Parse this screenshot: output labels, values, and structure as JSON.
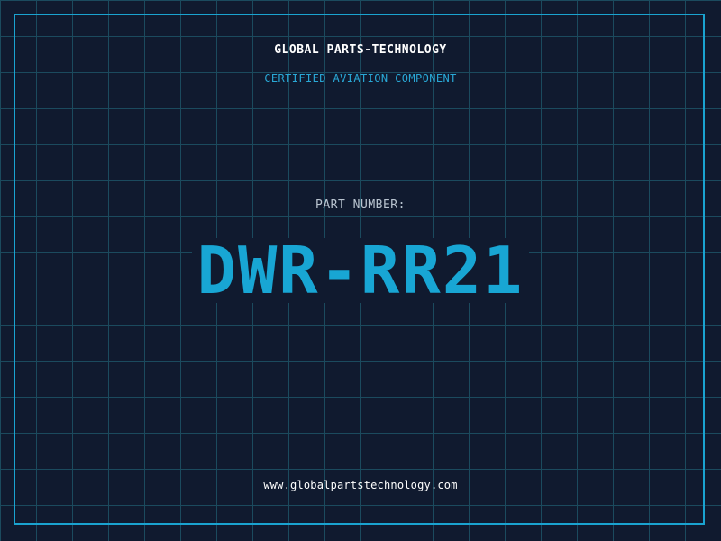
{
  "label": {
    "company": "GLOBAL PARTS-TECHNOLOGY",
    "tagline": "CERTIFIED AVIATION COMPONENT",
    "part_number_label": "PART NUMBER:",
    "part_number": "DWR-RR21",
    "website": "www.globalpartstechnology.com"
  },
  "colors": {
    "background": "#101a2f",
    "grid": "#1b4a5e",
    "accent": "#18a6d4",
    "frame": "#1aa3d0",
    "text_primary": "#ffffff",
    "text_muted": "#b9c4d0"
  }
}
